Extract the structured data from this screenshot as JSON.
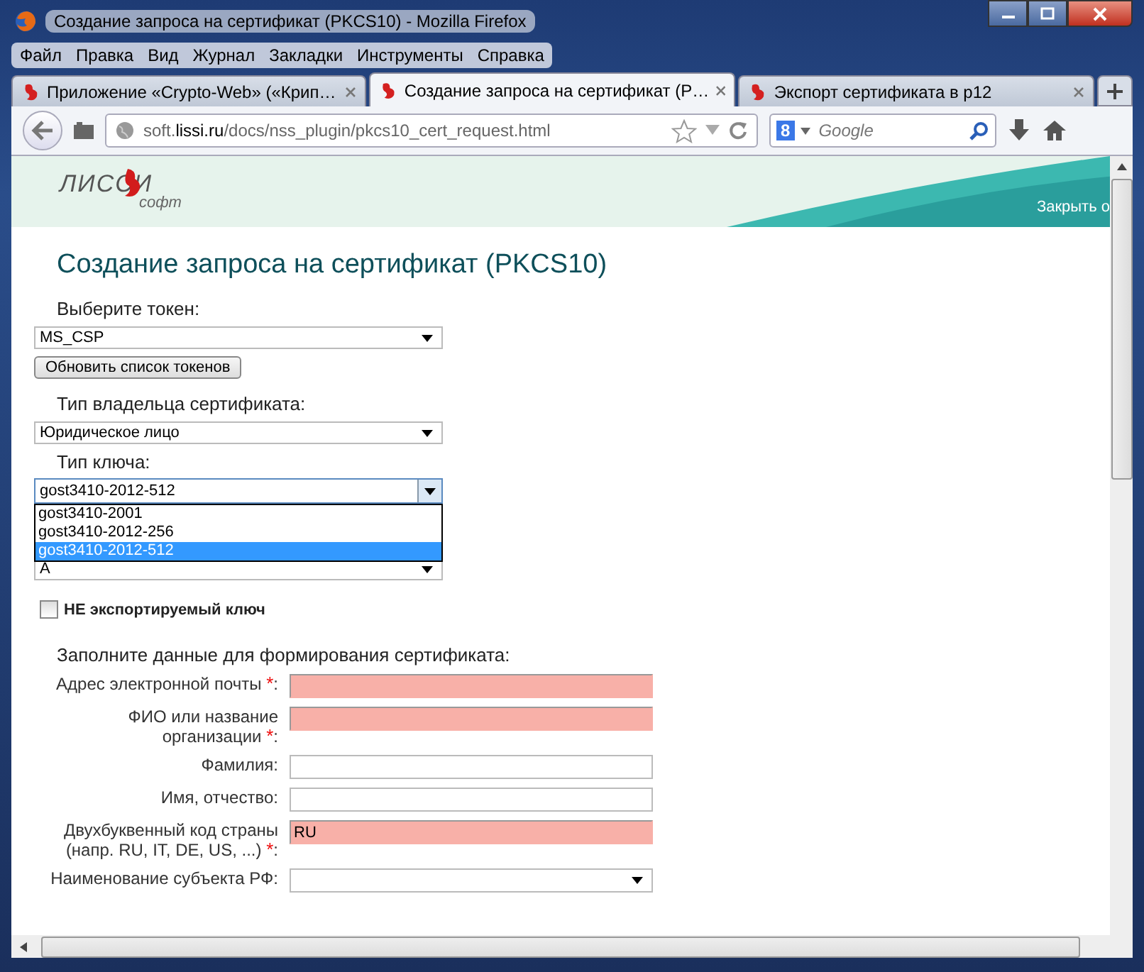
{
  "window": {
    "title": "Создание запроса на сертификат (PKCS10) - Mozilla Firefox"
  },
  "menu": [
    "Файл",
    "Правка",
    "Вид",
    "Журнал",
    "Закладки",
    "Инструменты",
    "Справка"
  ],
  "tabs": [
    {
      "label": "Приложение «Crypto-Web» («Крип…",
      "selected": false
    },
    {
      "label": "Создание запроса на сертификат (P…",
      "selected": true
    },
    {
      "label": "Экспорт сертификата в p12",
      "selected": false
    }
  ],
  "address": {
    "host": "soft.",
    "domain": "lissi.ru",
    "path": "/docs/nss_plugin/pkcs10_cert_request.html"
  },
  "search": {
    "engine": "8",
    "placeholder": "Google"
  },
  "header": {
    "logo_top": "ЛИССИ",
    "logo_bottom": "софт",
    "link": "Закрыть о"
  },
  "page": {
    "title": "Создание запроса на сертификат (PKCS10)",
    "token_label": "Выберите токен:",
    "token_value": "MS_CSP",
    "refresh_button": "Обновить список токенов",
    "owner_label": "Тип владельца сертификата:",
    "owner_value": "Юридическое лицо",
    "key_label": "Тип ключа:",
    "key_value": "gost3410-2012-512",
    "key_options": [
      {
        "label": "gost3410-2001",
        "selected": false
      },
      {
        "label": "gost3410-2012-256",
        "selected": false
      },
      {
        "label": "gost3410-2012-512",
        "selected": true
      }
    ],
    "param_value": "A",
    "nonexport": {
      "label": "НЕ экспортируемый ключ",
      "checked": false
    },
    "section": "Заполните данные для формирования сертификата:",
    "fields": [
      {
        "kind": "input",
        "label": "Адрес электронной почты",
        "asterisk": "*",
        "colon": ":"
      },
      {
        "kind": "input",
        "label": "ФИО или название организации",
        "asterisk": "*",
        "colon": ":"
      },
      {
        "kind": "input",
        "label": "Фамилия",
        "colon": ":"
      },
      {
        "kind": "input",
        "label": "Имя, отчество",
        "colon": ":"
      },
      {
        "kind": "input",
        "label": "Двухбуквенный код страны (напр. RU, IT, DE, US, ...)",
        "asterisk": "*",
        "colon": ":",
        "value": "RU"
      },
      {
        "kind": "select",
        "label": "Наименование субъекта РФ",
        "colon": ":"
      }
    ]
  }
}
